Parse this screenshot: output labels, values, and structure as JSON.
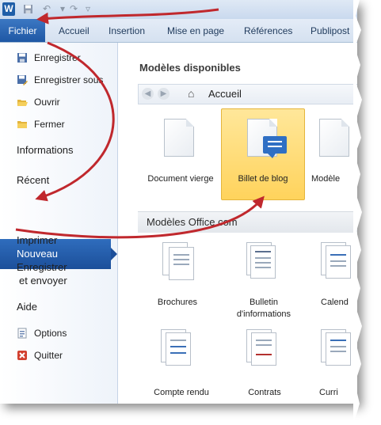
{
  "qat": {
    "app_icon_letter": "W"
  },
  "tabs": {
    "file": "Fichier",
    "items": [
      "Accueil",
      "Insertion",
      "Mise en page",
      "Références",
      "Publipost"
    ]
  },
  "left_menu": {
    "small_items_top": [
      "Enregistrer",
      "Enregistrer sous",
      "Ouvrir",
      "Fermer"
    ],
    "informations": "Informations",
    "recent": "Récent",
    "nouveau": "Nouveau",
    "imprimer": "Imprimer",
    "enregistrer_envoyer_1": "Enregistrer",
    "enregistrer_envoyer_2": "et envoyer",
    "aide": "Aide",
    "options": "Options",
    "quitter": "Quitter"
  },
  "right": {
    "available_title": "Modèles disponibles",
    "nav_label": "Accueil",
    "templates_top": [
      "Document vierge",
      "Billet de blog",
      "Modèle"
    ],
    "office_title": "Modèles Office.com",
    "office_row1": [
      "Brochures",
      "Bulletin",
      "d'informations",
      "Calend"
    ],
    "office_row2": [
      "Compte rendu",
      "Contrats",
      "Curri"
    ]
  },
  "colors": {
    "accent_blue": "#1f5ea8",
    "selected_yellow": "#ffd35c",
    "annotation_red": "#c0282d"
  }
}
